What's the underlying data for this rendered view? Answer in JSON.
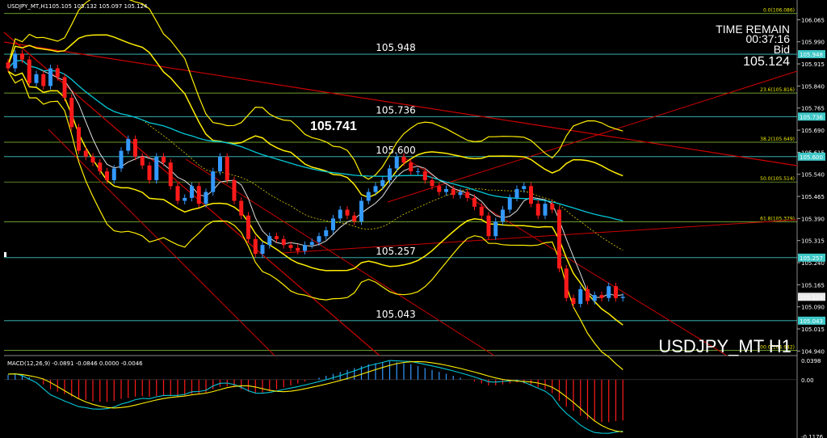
{
  "header": {
    "symbol": "USDJPY_MT,H1",
    "ohlc": "105.105 105.132 105.097 105.124",
    "watermark": "USDJPY_MT H1"
  },
  "timer": {
    "title": "TIME REMAIN",
    "countdown": "00:37:16",
    "bid_label": "Bid",
    "bid_value": "105.124"
  },
  "colors": {
    "bull": "#3399ff",
    "bear": "#ff1a1a",
    "bollinger": "#ffee00",
    "ma_fast": "#e0e0e0",
    "ma_slow": "#00c8d8",
    "level_line": "#3fc8c8",
    "fib_line": "#8bcf3b",
    "trend": "#cc0000"
  },
  "price_axis": {
    "ticks": [
      "106.065",
      "105.990",
      "105.915",
      "105.840",
      "105.765",
      "105.690",
      "105.615",
      "105.540",
      "105.465",
      "105.390",
      "105.315",
      "105.240",
      "105.165",
      "105.090",
      "105.015",
      "104.940"
    ],
    "markers": [
      {
        "value": "105.948",
        "color": "#3fc8c8"
      },
      {
        "value": "105.736",
        "color": "#3fc8c8"
      },
      {
        "value": "105.600",
        "color": "#3fc8c8"
      },
      {
        "value": "105.257",
        "color": "#3fc8c8"
      },
      {
        "value": "105.124",
        "color": "#e8e8e8"
      },
      {
        "value": "105.043",
        "color": "#3fc8c8"
      }
    ]
  },
  "levels": [
    {
      "price": 105.948,
      "label": "105.948"
    },
    {
      "price": 105.736,
      "label": "105.736"
    },
    {
      "price": 105.6,
      "label": "105.600"
    },
    {
      "price": 105.257,
      "label": "105.257"
    },
    {
      "price": 105.043,
      "label": "105.043"
    }
  ],
  "extra_label": "105.741",
  "fib_levels": [
    {
      "price": 106.086,
      "label": "0.0(106.086)"
    },
    {
      "price": 105.816,
      "label": "23.6(105.816)"
    },
    {
      "price": 105.649,
      "label": "38.2(105.649)"
    },
    {
      "price": 105.514,
      "label": "50.0(105.514)"
    },
    {
      "price": 105.379,
      "label": "61.8(105.379)"
    },
    {
      "price": 104.942,
      "label": "100.0(104.942)"
    }
  ],
  "macd": {
    "label": "MACD(12,26,9) -0.0891 -0.0846 0.0000 -0.0046",
    "ticks": [
      "0.0398",
      "0.00",
      "-0.1176"
    ]
  },
  "chart_data": {
    "type": "candlestick",
    "symbol": "USDJPY_MT",
    "timeframe": "H1",
    "y_range": [
      104.93,
      106.11
    ],
    "close": [
      105.9,
      105.95,
      105.93,
      105.85,
      105.88,
      105.84,
      105.9,
      105.87,
      105.8,
      105.7,
      105.62,
      105.6,
      105.58,
      105.55,
      105.52,
      105.56,
      105.62,
      105.66,
      105.6,
      105.57,
      105.52,
      105.6,
      105.58,
      105.5,
      105.45,
      105.46,
      105.5,
      105.44,
      105.48,
      105.55,
      105.6,
      105.52,
      105.45,
      105.4,
      105.32,
      105.27,
      105.3,
      105.33,
      105.32,
      105.3,
      105.29,
      105.28,
      105.3,
      105.31,
      105.33,
      105.35,
      105.39,
      105.42,
      105.4,
      105.38,
      105.45,
      105.48,
      105.5,
      105.52,
      105.56,
      105.6,
      105.58,
      105.55,
      105.55,
      105.52,
      105.5,
      105.48,
      105.49,
      105.47,
      105.48,
      105.46,
      105.43,
      105.4,
      105.33,
      105.38,
      105.42,
      105.46,
      105.49,
      105.5,
      105.44,
      105.4,
      105.44,
      105.42,
      105.22,
      105.12,
      105.1,
      105.15,
      105.11,
      105.13,
      105.12,
      105.16,
      105.12,
      105.124
    ],
    "macd": {
      "histogram": [
        0.01,
        0.012,
        0.01,
        0.005,
        0.0,
        -0.01,
        -0.02,
        -0.025,
        -0.03,
        -0.035,
        -0.04,
        -0.042,
        -0.045,
        -0.046,
        -0.046,
        -0.044,
        -0.04,
        -0.038,
        -0.035,
        -0.034,
        -0.036,
        -0.034,
        -0.033,
        -0.034,
        -0.035,
        -0.034,
        -0.03,
        -0.03,
        -0.028,
        -0.02,
        -0.015,
        -0.014,
        -0.016,
        -0.02,
        -0.025,
        -0.028,
        -0.027,
        -0.024,
        -0.02,
        -0.016,
        -0.012,
        -0.008,
        -0.004,
        0.0,
        0.004,
        0.008,
        0.012,
        0.016,
        0.02,
        0.024,
        0.028,
        0.032,
        0.034,
        0.036,
        0.038,
        0.036,
        0.034,
        0.032,
        0.028,
        0.024,
        0.02,
        0.016,
        0.012,
        0.008,
        0.004,
        0.0,
        -0.004,
        -0.008,
        -0.012,
        -0.012,
        -0.01,
        -0.008,
        -0.006,
        -0.008,
        -0.012,
        -0.016,
        -0.02,
        -0.028,
        -0.044,
        -0.056,
        -0.065,
        -0.075,
        -0.082,
        -0.087,
        -0.088,
        -0.088,
        -0.086,
        -0.0846
      ],
      "signal_label": "0.0000"
    }
  }
}
